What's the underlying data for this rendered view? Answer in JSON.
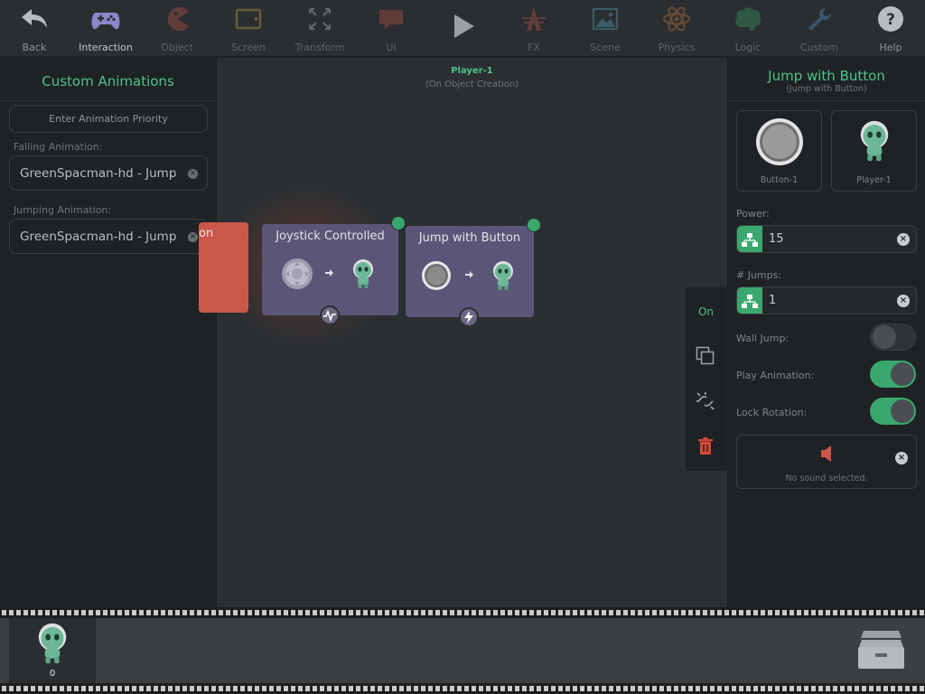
{
  "toolbar": {
    "items": [
      {
        "label": "Back",
        "icon": "back-arrow-icon",
        "state": "normal"
      },
      {
        "label": "Interaction",
        "icon": "gamepad-icon",
        "state": "active"
      },
      {
        "label": "Object",
        "icon": "pacman-icon",
        "state": "dim"
      },
      {
        "label": "Screen",
        "icon": "screen-icon",
        "state": "dim"
      },
      {
        "label": "Transform",
        "icon": "transform-icon",
        "state": "dim"
      },
      {
        "label": "UI",
        "icon": "speech-bubble-icon",
        "state": "dim"
      },
      {
        "label": "",
        "icon": "play-icon",
        "state": "normal"
      },
      {
        "label": "FX",
        "icon": "fx-icon",
        "state": "dim"
      },
      {
        "label": "Scene",
        "icon": "scene-image-icon",
        "state": "dim"
      },
      {
        "label": "Physics",
        "icon": "atom-icon",
        "state": "dim"
      },
      {
        "label": "Logic",
        "icon": "brain-icon",
        "state": "dim"
      },
      {
        "label": "Custom",
        "icon": "wrench-icon",
        "state": "dim"
      },
      {
        "label": "Help",
        "icon": "help-icon",
        "state": "normal"
      }
    ]
  },
  "left_panel": {
    "title": "Custom Animations",
    "priority_placeholder": "Enter Animation Priority",
    "falling": {
      "label": "Falling Animation:",
      "value": "GreenSpacman-hd - Jump"
    },
    "jumping": {
      "label": "Jumping Animation:",
      "value": "GreenSpacman-hd - Jump"
    }
  },
  "canvas": {
    "object_name": "Player-1",
    "event": "(On Object Creation)",
    "nodes": [
      {
        "title": "on",
        "color": "#c9574a"
      },
      {
        "title": "Joystick Controlled"
      },
      {
        "title": "Jump with Button"
      }
    ]
  },
  "side_actions": {
    "on_label": "On"
  },
  "right_panel": {
    "title": "Jump with Button",
    "subtitle": "(Jump with Button)",
    "cards": [
      {
        "label": "Button-1"
      },
      {
        "label": "Player-1"
      }
    ],
    "power": {
      "label": "Power:",
      "value": "15"
    },
    "jumps": {
      "label": "# Jumps:",
      "value": "1"
    },
    "toggles": [
      {
        "label": "Wall Jump:",
        "on": false
      },
      {
        "label": "Play Animation:",
        "on": true
      },
      {
        "label": "Lock Rotation:",
        "on": true
      }
    ],
    "sound": {
      "text": "No sound selected."
    }
  },
  "bottom": {
    "object_count": "0"
  },
  "colors": {
    "accent": "#4cc38a",
    "node": "#5b5678",
    "node_red": "#c9574a",
    "delete": "#d9483b"
  }
}
